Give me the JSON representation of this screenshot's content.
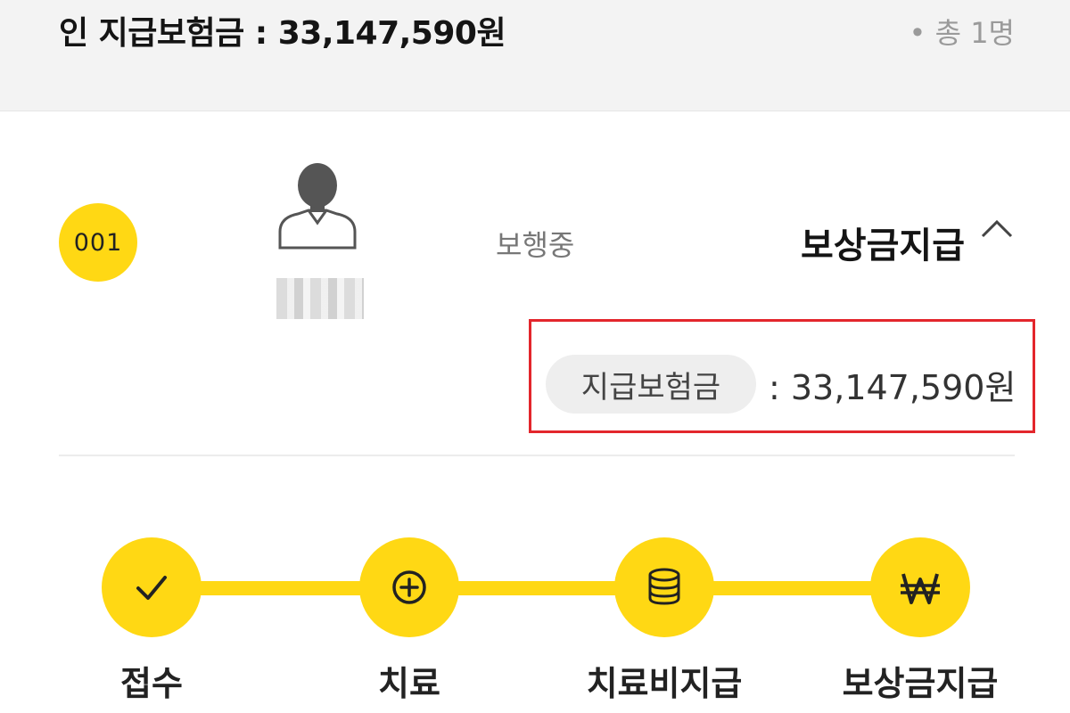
{
  "header": {
    "title": "인 지급보험금 : 33,147,590원",
    "count": "• 총 1명"
  },
  "person": {
    "number": "001",
    "avatar_icon": "user-avatar-icon",
    "status": "보행중",
    "stage": "보상금지급",
    "toggle_icon": "chevron-up-icon"
  },
  "payout": {
    "label": "지급보험금",
    "amount": ": 33,147,590원"
  },
  "progress": {
    "steps": [
      {
        "label": "접수",
        "icon": "check-icon"
      },
      {
        "label": "치료",
        "icon": "plus-circle-icon"
      },
      {
        "label": "치료비지급",
        "icon": "coin-stack-icon"
      },
      {
        "label": "보상금지급",
        "icon": "won-icon"
      }
    ]
  },
  "colors": {
    "accent": "#ffd814",
    "highlight_border": "#e3262c",
    "header_bg": "#f3f3f3"
  }
}
